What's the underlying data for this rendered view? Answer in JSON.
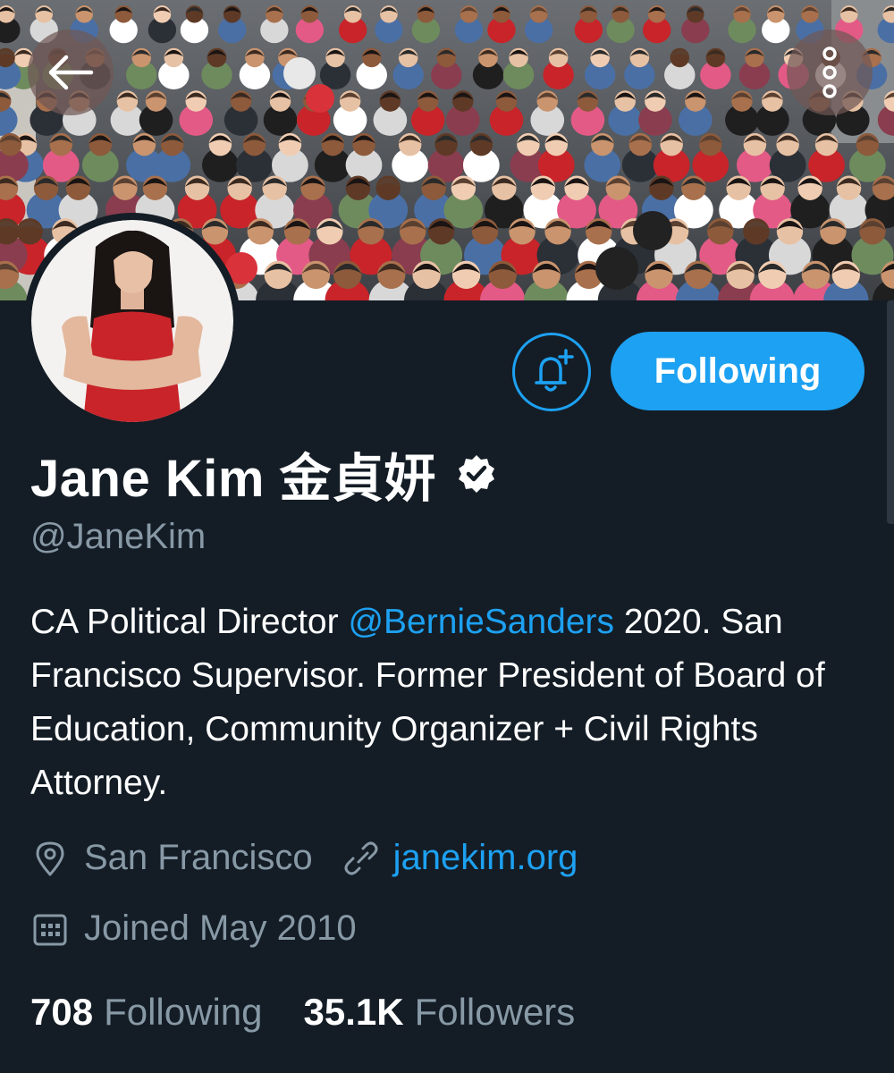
{
  "header": {
    "back_icon": "arrow-left-icon",
    "more_icon": "vertical-dots-icon"
  },
  "profile": {
    "display_name": "Jane Kim  金貞妍",
    "verified_icon": "verified-badge-icon",
    "handle": "@JaneKim",
    "bio": {
      "part1": "CA Political Director ",
      "mention": "@BernieSanders",
      "part2": " 2020. San Francisco Supervisor. Former President of Board of Education, Community Organizer + Civil Rights Attorney."
    },
    "location": "San Francisco",
    "website": "janekim.org",
    "joined": "Joined May 2010"
  },
  "actions": {
    "notify_icon": "bell-plus-icon",
    "following_label": "Following"
  },
  "stats": {
    "following_count": "708",
    "following_label": "Following",
    "followers_count": "35.1K",
    "followers_label": "Followers"
  },
  "colors": {
    "background": "#141d26",
    "accent": "#1da1f2",
    "secondary_text": "#8899a6"
  }
}
